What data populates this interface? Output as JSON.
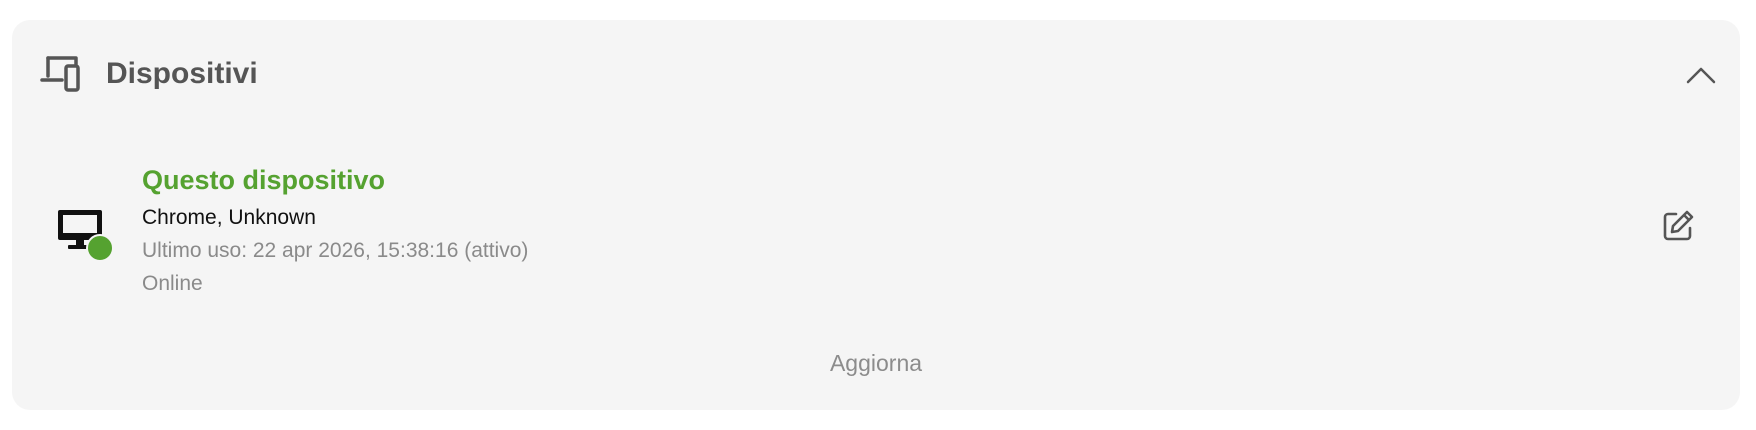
{
  "panel": {
    "title": "Dispositivi",
    "header_icon": "devices-icon",
    "toggle_icon": "chevron-up-icon",
    "expanded": true
  },
  "devices": [
    {
      "name": "Questo dispositivo",
      "browser": "Chrome, Unknown",
      "last_use": "Ultimo uso: 22 apr 2026, 15:38:16 (attivo)",
      "status": "Online",
      "icon": "desktop-icon",
      "status_dot_color": "#55a230",
      "edit_icon": "edit-icon"
    }
  ],
  "actions": {
    "refresh_label": "Aggiorna"
  },
  "colors": {
    "accent_green": "#55a230",
    "card_background": "#f5f5f5"
  }
}
